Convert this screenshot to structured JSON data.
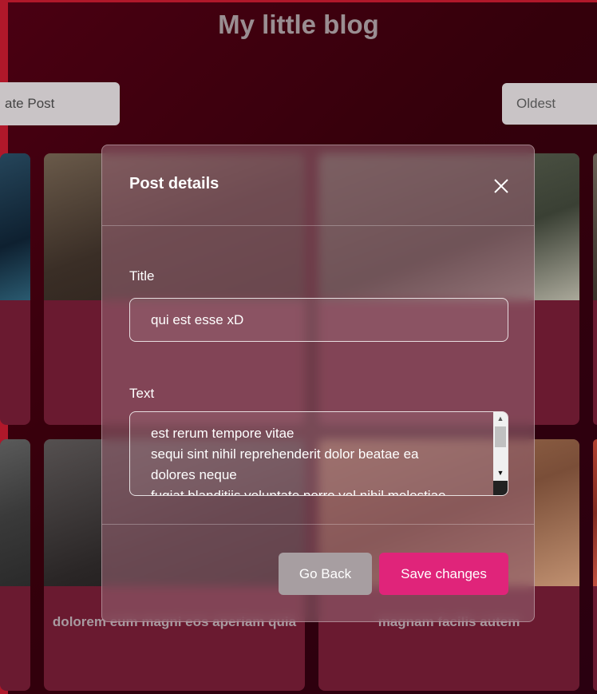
{
  "page": {
    "blog_title": "My little blog",
    "create_post_label": "ate Post",
    "sort_value": "Oldest"
  },
  "cards": [
    {
      "caption": ""
    },
    {
      "caption": "dolorem eum magni eos aperiam quia"
    },
    {
      "caption": "magnam facilis autem"
    }
  ],
  "modal": {
    "title": "Post details",
    "title_label": "Title",
    "title_value": "qui est esse xD",
    "text_label": "Text",
    "text_lines": [
      "est rerum tempore vitae",
      "sequi sint nihil reprehenderit dolor beatae ea",
      "dolores neque",
      "fugiat blanditiis voluptate porro vel nihil molestiae"
    ],
    "back_label": "Go Back",
    "save_label": "Save changes"
  },
  "colors": {
    "accent": "#e0247a",
    "background": "#34000b",
    "secondary_button": "#a79ea1"
  }
}
